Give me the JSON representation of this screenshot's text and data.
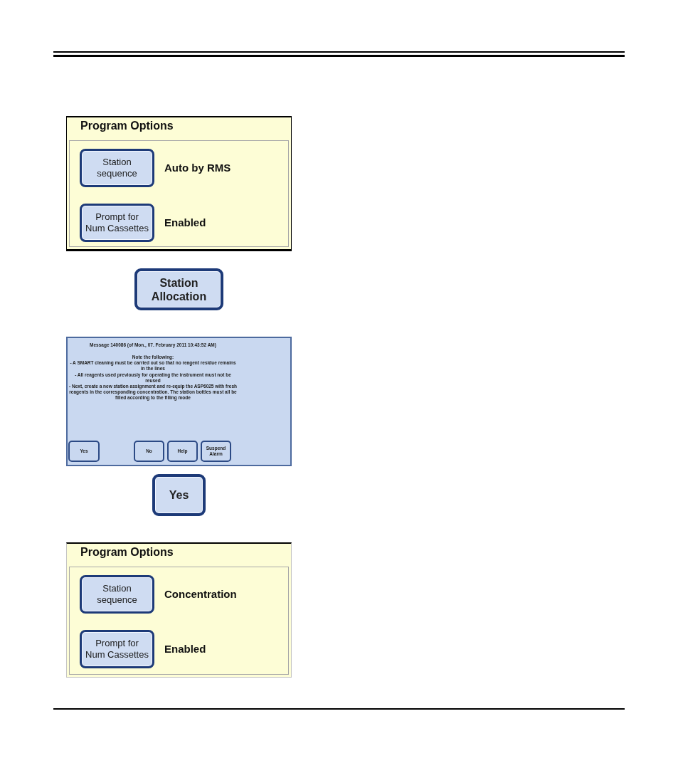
{
  "sections": [
    {
      "kind": "options_panel",
      "title": "Program Options",
      "options": [
        {
          "button": "Station\nsequence",
          "value": "Auto by RMS"
        },
        {
          "button": "Prompt for\nNum Cassettes",
          "value": "Enabled"
        }
      ]
    },
    {
      "kind": "button",
      "label": "Station\nAllocation"
    },
    {
      "kind": "message",
      "header": "Message 140086 (of Mon., 07. February 2011 10:43:52 AM)",
      "lines": [
        "Note the following:",
        "- A SMART cleaning must be carried out so that no reagent residue remains in the lines",
        "- All reagents used previously for operating the instrument must not be reused",
        "- Next, create a new station assignment and re-equip the ASP6025 with fresh reagents in the corresponding concentration. The station bottles must all be filled according to the filling mode"
      ],
      "buttons": [
        "Yes",
        "No",
        "Help",
        "Suspend\nAlarm"
      ]
    },
    {
      "kind": "button",
      "label": "Yes"
    },
    {
      "kind": "options_panel",
      "title": "Program Options",
      "options": [
        {
          "button": "Station\nsequence",
          "value": "Concentration"
        },
        {
          "button": "Prompt for\nNum Cassettes",
          "value": "Enabled"
        }
      ]
    }
  ]
}
